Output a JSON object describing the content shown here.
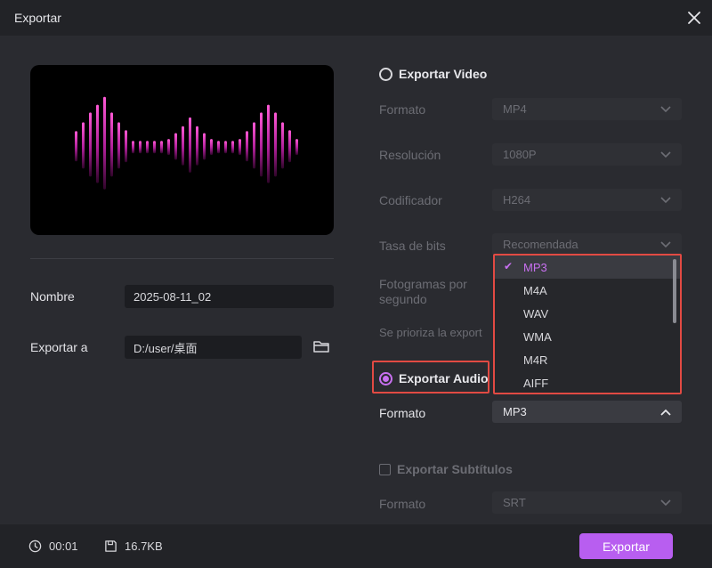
{
  "window": {
    "title": "Exportar"
  },
  "left": {
    "name_label": "Nombre",
    "name_value": "2025-08-11_02",
    "export_to_label": "Exportar a",
    "export_path": "D:/user/桌面"
  },
  "video": {
    "title": "Exportar Video",
    "selected": false,
    "format_label": "Formato",
    "format_value": "MP4",
    "resolution_label": "Resolución",
    "resolution_value": "1080P",
    "encoder_label": "Codificador",
    "encoder_value": "H264",
    "bitrate_label": "Tasa de bits",
    "bitrate_value": "Recomendada",
    "fps_label_line1": "Fotogramas por",
    "fps_label_line2": "segundo",
    "priority_text": "Se prioriza la export"
  },
  "audio": {
    "title": "Exportar Audio",
    "selected": true,
    "format_label": "Formato",
    "format_value": "MP3",
    "options": [
      {
        "label": "MP3",
        "selected": true
      },
      {
        "label": "M4A",
        "selected": false
      },
      {
        "label": "WAV",
        "selected": false
      },
      {
        "label": "WMA",
        "selected": false
      },
      {
        "label": "M4R",
        "selected": false
      },
      {
        "label": "AIFF",
        "selected": false
      }
    ]
  },
  "subtitles": {
    "title": "Exportar Subtítulos",
    "checked": false,
    "format_label": "Formato",
    "format_value": "SRT"
  },
  "footer": {
    "duration": "00:01",
    "size": "16.7KB",
    "export_label": "Exportar"
  },
  "colors": {
    "accent": "#b85ef0",
    "highlight": "#e24a43",
    "wave": "#e040c0"
  }
}
